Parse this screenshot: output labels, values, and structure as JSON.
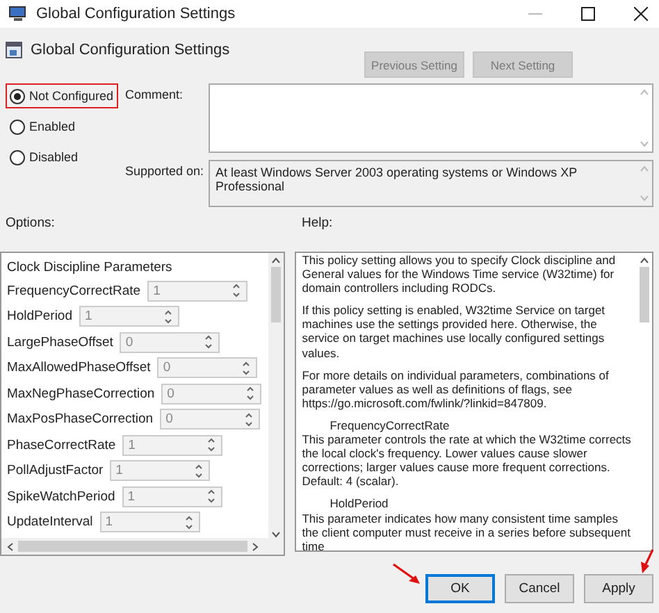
{
  "window": {
    "title": "Global Configuration Settings"
  },
  "header": {
    "title": "Global Configuration Settings",
    "nav_buttons": [
      {
        "label": "Previous Setting",
        "disabled": true
      },
      {
        "label": "Next Setting",
        "disabled": true
      }
    ]
  },
  "state_options": [
    {
      "label": "Not Configured",
      "selected": true,
      "highlighted": true
    },
    {
      "label": "Enabled",
      "selected": false,
      "highlighted": false
    },
    {
      "label": "Disabled",
      "selected": false,
      "highlighted": false
    }
  ],
  "comment": {
    "label": "Comment:"
  },
  "supported_on": {
    "label": "Supported on:",
    "value": "At least Windows Server 2003 operating systems or Windows XP Professional"
  },
  "options": {
    "label": "Options:",
    "heading": "Clock Discipline Parameters",
    "params": [
      {
        "name": "FrequencyCorrectRate",
        "value": "1"
      },
      {
        "name": "HoldPeriod",
        "value": "1"
      },
      {
        "name": "LargePhaseOffset",
        "value": "0"
      },
      {
        "name": "MaxAllowedPhaseOffset",
        "value": "0"
      },
      {
        "name": "MaxNegPhaseCorrection",
        "value": "0"
      },
      {
        "name": "MaxPosPhaseCorrection",
        "value": "0"
      },
      {
        "name": "PhaseCorrectRate",
        "value": "1"
      },
      {
        "name": "PollAdjustFactor",
        "value": "1"
      },
      {
        "name": "SpikeWatchPeriod",
        "value": "1"
      },
      {
        "name": "UpdateInterval",
        "value": "1"
      }
    ]
  },
  "help": {
    "label": "Help:",
    "paragraphs": [
      {
        "kind": "text",
        "text": "This policy setting allows you to specify Clock discipline and General values for the Windows Time service (W32time) for domain controllers including RODCs."
      },
      {
        "kind": "text",
        "text": "If this policy setting is enabled, W32time Service on target machines use the settings provided here. Otherwise, the service on target machines use locally configured settings values."
      },
      {
        "kind": "text",
        "text": "For more details on individual parameters, combinations of parameter values as well as definitions of flags, see https://go.microsoft.com/fwlink/?linkid=847809."
      },
      {
        "kind": "heading",
        "text": "FrequencyCorrectRate"
      },
      {
        "kind": "text",
        "text": "This parameter controls the rate at which the W32time corrects the local clock's frequency. Lower values cause slower corrections; larger values cause more frequent corrections. Default: 4 (scalar)."
      },
      {
        "kind": "heading",
        "text": "HoldPeriod"
      },
      {
        "kind": "text",
        "text": "This parameter indicates how many consistent time samples the client computer must receive in a series before subsequent time"
      }
    ]
  },
  "buttons": [
    {
      "label": "OK",
      "default": true,
      "arrow": true
    },
    {
      "label": "Cancel",
      "default": false,
      "arrow": false
    },
    {
      "label": "Apply",
      "default": false,
      "arrow": true
    }
  ]
}
